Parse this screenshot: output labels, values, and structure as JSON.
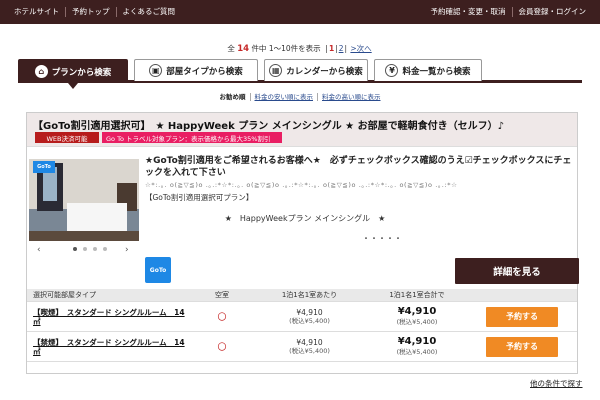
{
  "topbar": {
    "left": [
      "ホテルサイト",
      "予約トップ",
      "よくあるご質問"
    ],
    "right": [
      "予約確認・変更・取消",
      "会員登録・ログイン"
    ]
  },
  "pager": {
    "prefix": "全",
    "count": "14",
    "mid": "件中 1〜10件を表示",
    "pages": [
      "1",
      "2"
    ],
    "next": ">次へ"
  },
  "tabs": [
    {
      "label": "プランから検索",
      "icon": "plan-icon",
      "glyph": "⌂"
    },
    {
      "label": "部屋タイプから検索",
      "icon": "room-icon",
      "glyph": "▣"
    },
    {
      "label": "カレンダーから検索",
      "icon": "calendar-icon",
      "glyph": "▦"
    },
    {
      "label": "料金一覧から検索",
      "icon": "price-icon",
      "glyph": "¥"
    }
  ],
  "sort": {
    "current": "お勧め順",
    "cheap": "料金の安い順に表示",
    "expensive": "料金の高い順に表示"
  },
  "plan": {
    "title": "【GoTo割引適用選択可】　★ HappyWeek プラン メインシングル ★ お部屋で軽朝食付き（セルフ）♪",
    "badge_web": "WEB決済可能",
    "badge_goto": "Go To トラベル対象プラン：表示価格から最大35%割引",
    "photo_logo": "GoTo",
    "description": "★GoTo割引適用をご希望されるお客様へ★　必ずチェックボックス確認のうえ☑チェックボックスにチェックを入れて下さい",
    "stars": "☆*:.｡. o(≧▽≦)o .｡.:*☆*:.｡. o(≧▽≦)o .｡.:*☆*:.｡. o(≧▽≦)o .｡.:*☆*:.｡. o(≧▽≦)o .｡.:*☆",
    "sub": "【GoTo割引適用選択可プラン】",
    "mid": "★　HappyWeekプラン メインシングル　★",
    "ellipsis": "・・・・・",
    "goto_logo": "GoTo",
    "detail_label": "詳細を見る"
  },
  "rooms": {
    "headers": [
      "選択可能部屋タイプ",
      "空室",
      "1泊1名1室あたり",
      "1泊1名1室合計で",
      ""
    ],
    "rows": [
      {
        "name": "【喫煙】　スタンダード シングルルーム　14㎡",
        "vacancy": "〇",
        "price": "¥4,910",
        "price_tax": "(税込¥5,400)",
        "total": "¥4,910",
        "total_tax": "(税込¥5,400)",
        "book": "予約する"
      },
      {
        "name": "【禁煙】　スタンダード シングルルーム　14㎡",
        "vacancy": "〇",
        "price": "¥4,910",
        "price_tax": "(税込¥5,400)",
        "total": "¥4,910",
        "total_tax": "(税込¥5,400)",
        "book": "予約する"
      }
    ]
  },
  "more_link": "他の条件で探す",
  "colors": {
    "brand": "#3d1f1f",
    "accent": "#f08a24",
    "web_badge": "#b71c1c",
    "goto_badge": "#e91e63"
  }
}
